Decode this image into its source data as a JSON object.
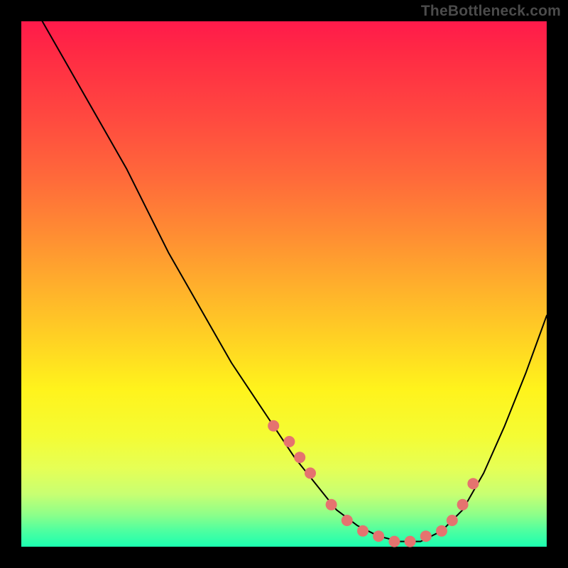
{
  "watermark": "TheBottleneck.com",
  "chart_data": {
    "type": "line",
    "title": "",
    "xlabel": "",
    "ylabel": "",
    "xlim": [
      0,
      100
    ],
    "ylim": [
      0,
      100
    ],
    "grid": false,
    "series": [
      {
        "name": "curve",
        "x": [
          4,
          8,
          12,
          16,
          20,
          24,
          28,
          32,
          36,
          40,
          44,
          48,
          52,
          56,
          60,
          64,
          68,
          72,
          76,
          80,
          84,
          88,
          92,
          96,
          100
        ],
        "y": [
          100,
          93,
          86,
          79,
          72,
          64,
          56,
          49,
          42,
          35,
          29,
          23,
          17,
          12,
          7,
          4,
          2,
          1,
          1,
          3,
          7,
          14,
          23,
          33,
          44
        ]
      }
    ],
    "highlight_points": {
      "name": "dots",
      "color": "#e5736f",
      "x": [
        48,
        51,
        53,
        55,
        59,
        62,
        65,
        68,
        71,
        74,
        77,
        80,
        82,
        84,
        86
      ],
      "y": [
        23,
        20,
        17,
        14,
        8,
        5,
        3,
        2,
        1,
        1,
        2,
        3,
        5,
        8,
        12
      ]
    }
  }
}
